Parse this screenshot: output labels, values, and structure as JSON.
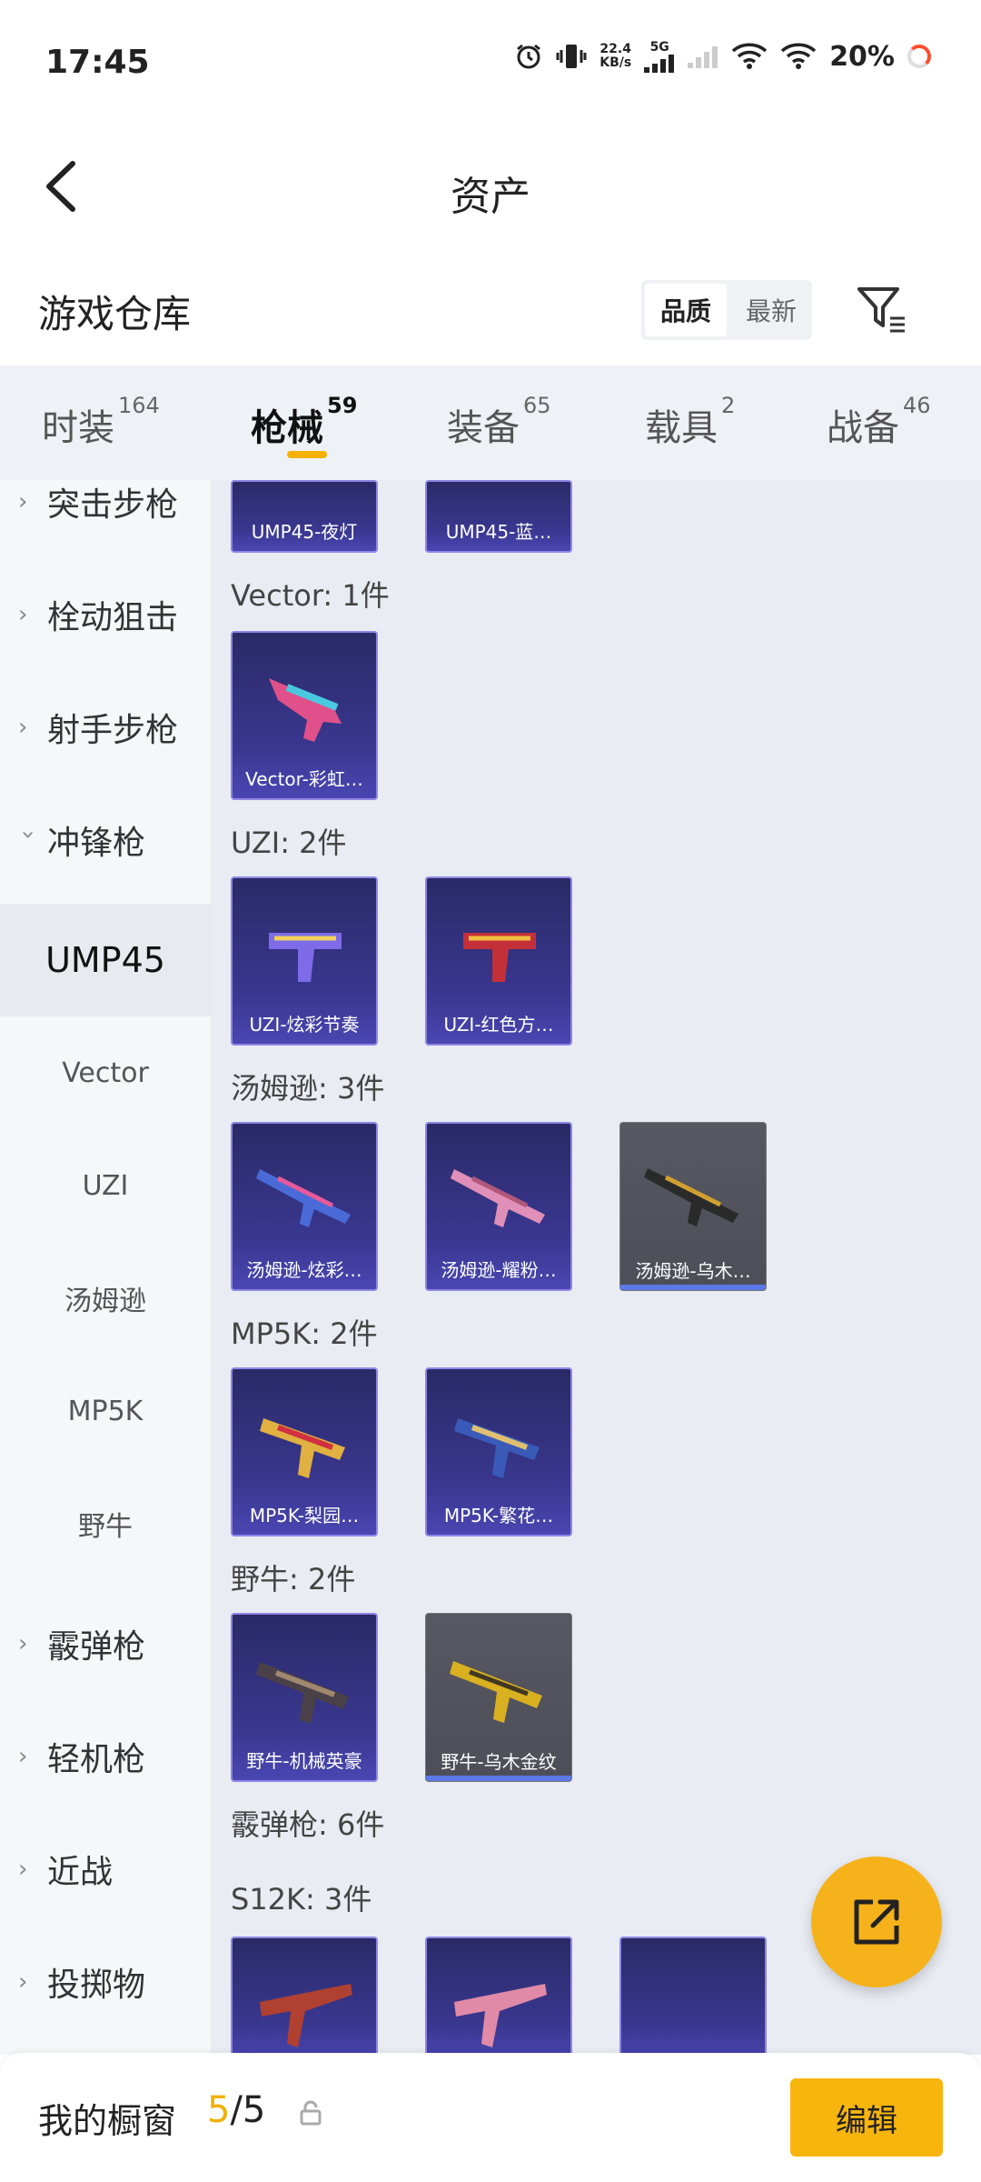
{
  "status": {
    "time": "17:45",
    "net_speed_value": "22.4",
    "net_speed_unit": "KB/s",
    "net_type": "5G",
    "battery": "20%"
  },
  "header": {
    "title": "资产"
  },
  "warehouse": {
    "label": "游戏仓库",
    "sort_options": [
      "品质",
      "最新"
    ],
    "sort_selected": "品质"
  },
  "tabs": [
    {
      "label": "时装",
      "count": "164"
    },
    {
      "label": "枪械",
      "count": "59"
    },
    {
      "label": "装备",
      "count": "65"
    },
    {
      "label": "载具",
      "count": "2"
    },
    {
      "label": "战备",
      "count": "46"
    }
  ],
  "sidebar": {
    "categories": {
      "assault": "突击步枪",
      "bolt": "栓动狙击",
      "marksman": "射手步枪",
      "smg": "冲锋枪",
      "shotgun": "霰弹枪",
      "lmg": "轻机枪",
      "melee": "近战",
      "throwable": "投掷物"
    },
    "smg_items": [
      "UMP45",
      "Vector",
      "UZI",
      "汤姆逊",
      "MP5K",
      "野牛"
    ]
  },
  "groups": [
    {
      "title": "",
      "items": [
        "UMP45-夜灯",
        "UMP45-蓝…"
      ]
    },
    {
      "title": "Vector: 1件",
      "items": [
        "Vector-彩虹…"
      ]
    },
    {
      "title": "UZI: 2件",
      "items": [
        "UZI-炫彩节奏",
        "UZI-红色方…"
      ]
    },
    {
      "title": "汤姆逊: 3件",
      "items": [
        "汤姆逊-炫彩…",
        "汤姆逊-耀粉…",
        "汤姆逊-乌木…"
      ]
    },
    {
      "title": "MP5K: 2件",
      "items": [
        "MP5K-梨园…",
        "MP5K-繁花…"
      ]
    },
    {
      "title": "野牛: 2件",
      "items": [
        "野牛-机械英豪",
        "野牛-乌木金纹"
      ]
    },
    {
      "title": "霰弹枪: 6件",
      "items": []
    },
    {
      "title": "S12K: 3件",
      "items": []
    }
  ],
  "bottom": {
    "label": "我的橱窗",
    "current": "5",
    "total": "/5",
    "edit_label": "编辑"
  }
}
